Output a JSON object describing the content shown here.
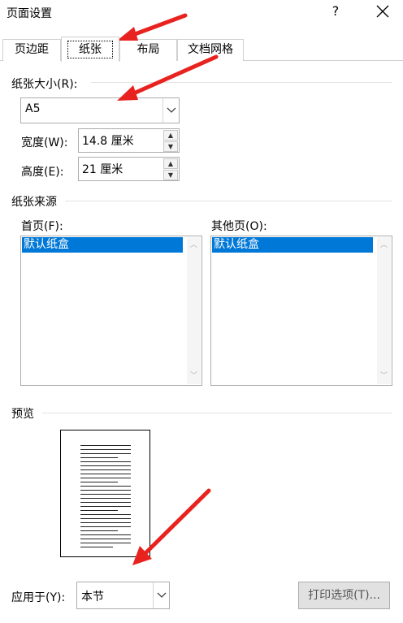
{
  "window": {
    "title": "页面设置",
    "help_label": "?"
  },
  "tabs": [
    {
      "label": "页边距"
    },
    {
      "label": "纸张"
    },
    {
      "label": "布局"
    },
    {
      "label": "文档网格"
    }
  ],
  "active_tab": "纸张",
  "paper_size": {
    "section_label": "纸张大小(R):",
    "selected": "A5",
    "width_label": "宽度(W):",
    "width_value": "14.8 厘米",
    "height_label": "高度(E):",
    "height_value": "21 厘米"
  },
  "paper_source": {
    "section_label": "纸张来源",
    "first_page_label": "首页(F):",
    "first_page_items": [
      "默认纸盒"
    ],
    "other_pages_label": "其他页(O):",
    "other_pages_items": [
      "默认纸盒"
    ]
  },
  "preview": {
    "section_label": "预览"
  },
  "footer": {
    "apply_label": "应用于(Y):",
    "apply_value": "本节",
    "print_options_label": "打印选项(T)..."
  },
  "colors": {
    "selection": "#0078d7",
    "annotation_arrow": "#e8231f"
  }
}
